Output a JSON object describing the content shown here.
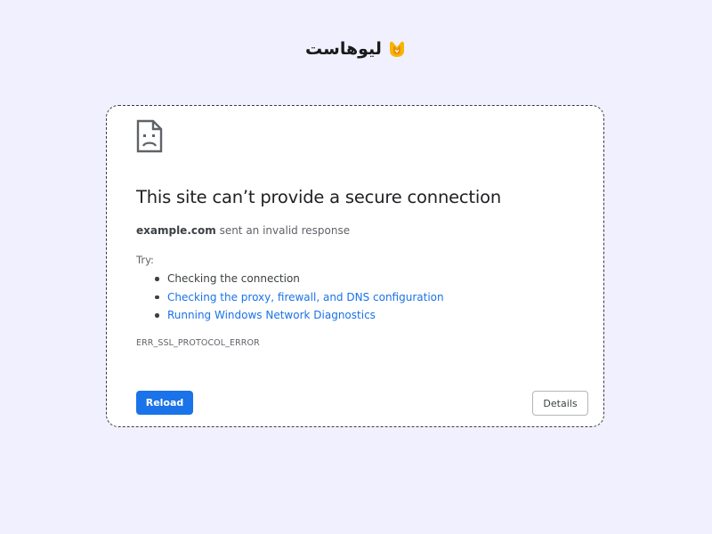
{
  "brand": {
    "name": "لیوهاست",
    "logo_icon": "liohost-logo-icon",
    "logo_colors": [
      "#f7b500",
      "#e8910c"
    ]
  },
  "error_page": {
    "icon": "sad-page-icon",
    "title": "This site can’t provide a secure connection",
    "host": "example.com",
    "message": " sent an invalid response",
    "try_label": "Try:",
    "suggestions": [
      {
        "text": "Checking the connection",
        "is_link": false
      },
      {
        "text": "Checking the proxy, firewall, and DNS configuration",
        "is_link": true
      },
      {
        "text": "Running Windows Network Diagnostics",
        "is_link": true
      }
    ],
    "error_code": "ERR_SSL_PROTOCOL_ERROR",
    "reload_label": "Reload",
    "details_label": "Details"
  },
  "colors": {
    "background": "#f1f0fe",
    "primary_button": "#1a73e8",
    "link": "#1a73e8"
  }
}
